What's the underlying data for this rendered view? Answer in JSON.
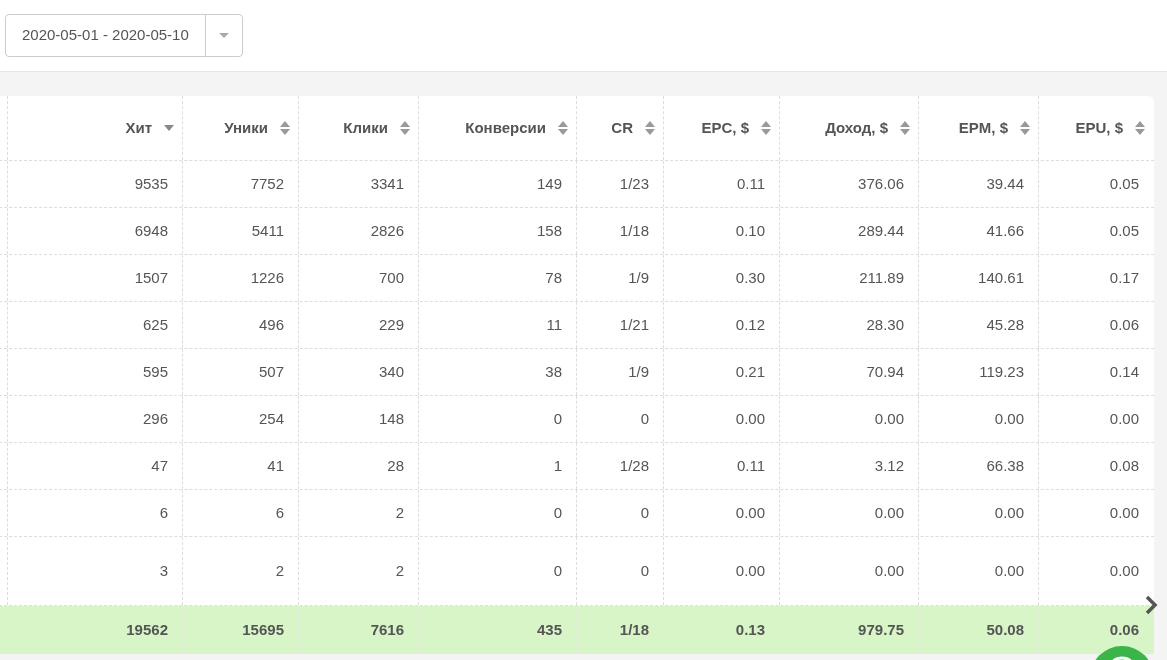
{
  "date_range": {
    "value": "2020-05-01 - 2020-05-10"
  },
  "table": {
    "columns": [
      {
        "label": "Хит",
        "sorted": true
      },
      {
        "label": "Уники",
        "sorted": false
      },
      {
        "label": "Клики",
        "sorted": false
      },
      {
        "label": "Конверсии",
        "sorted": false
      },
      {
        "label": "CR",
        "sorted": false
      },
      {
        "label": "EPC, $",
        "sorted": false
      },
      {
        "label": "Доход, $",
        "sorted": false
      },
      {
        "label": "EPM, $",
        "sorted": false
      },
      {
        "label": "EPU, $",
        "sorted": false
      }
    ],
    "rows": [
      [
        "9535",
        "7752",
        "3341",
        "149",
        "1/23",
        "0.11",
        "376.06",
        "39.44",
        "0.05"
      ],
      [
        "6948",
        "5411",
        "2826",
        "158",
        "1/18",
        "0.10",
        "289.44",
        "41.66",
        "0.05"
      ],
      [
        "1507",
        "1226",
        "700",
        "78",
        "1/9",
        "0.30",
        "211.89",
        "140.61",
        "0.17"
      ],
      [
        "625",
        "496",
        "229",
        "11",
        "1/21",
        "0.12",
        "28.30",
        "45.28",
        "0.06"
      ],
      [
        "595",
        "507",
        "340",
        "38",
        "1/9",
        "0.21",
        "70.94",
        "119.23",
        "0.14"
      ],
      [
        "296",
        "254",
        "148",
        "0",
        "0",
        "0.00",
        "0.00",
        "0.00",
        "0.00"
      ],
      [
        "47",
        "41",
        "28",
        "1",
        "1/28",
        "0.11",
        "3.12",
        "66.38",
        "0.08"
      ],
      [
        "6",
        "6",
        "2",
        "0",
        "0",
        "0.00",
        "0.00",
        "0.00",
        "0.00"
      ],
      [
        "3",
        "2",
        "2",
        "0",
        "0",
        "0.00",
        "0.00",
        "0.00",
        "0.00"
      ]
    ],
    "totals": [
      "19562",
      "15695",
      "7616",
      "435",
      "1/18",
      "0.13",
      "979.75",
      "50.08",
      "0.06"
    ]
  }
}
